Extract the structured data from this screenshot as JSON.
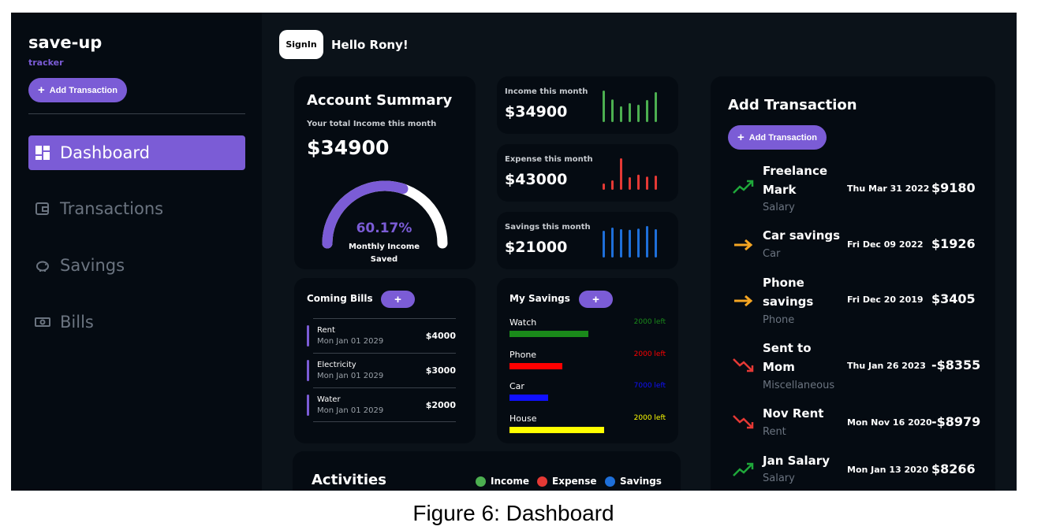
{
  "app": {
    "title": "save-up",
    "subtitle": "tracker"
  },
  "sidebar": {
    "add_button": "Add Transaction",
    "items": [
      {
        "label": "Dashboard",
        "icon": "dashboard-icon",
        "active": true
      },
      {
        "label": "Transactions",
        "icon": "wallet-icon"
      },
      {
        "label": "Savings",
        "icon": "piggy-bank-icon"
      },
      {
        "label": "Bills",
        "icon": "banknote-icon"
      }
    ]
  },
  "header": {
    "signin_label": "SignIn",
    "greeting": "Hello Rony!"
  },
  "account_summary": {
    "title": "Account Summary",
    "subtitle": "Your total Income this month",
    "amount": "$34900",
    "percent_text": "60.17%",
    "percent_value": 0.6017,
    "label": "Monthly Income Saved"
  },
  "stats": [
    {
      "label": "Income this month",
      "value": "$34900",
      "color": "#4caf50",
      "bars": [
        1.0,
        0.72,
        0.5,
        0.6,
        0.55,
        0.7,
        0.95
      ]
    },
    {
      "label": "Expense this month",
      "value": "$43000",
      "color": "#e53935",
      "bars": [
        0.2,
        0.3,
        1.0,
        0.4,
        0.48,
        0.42,
        0.45
      ]
    },
    {
      "label": "Savings this month",
      "value": "$21000",
      "color": "#1e6fd9",
      "bars": [
        0.85,
        0.95,
        0.9,
        0.88,
        0.92,
        1.0,
        0.9
      ]
    }
  ],
  "coming_bills": {
    "title": "Coming Bills",
    "add_label": "+",
    "items": [
      {
        "name": "Rent",
        "date": "Mon Jan 01 2029",
        "amount": "$4000"
      },
      {
        "name": "Electricity",
        "date": "Mon Jan 01 2029",
        "amount": "$3000"
      },
      {
        "name": "Water",
        "date": "Mon Jan 01 2029",
        "amount": "$2000"
      }
    ]
  },
  "my_savings": {
    "title": "My Savings",
    "add_label": "+",
    "items": [
      {
        "name": "Watch",
        "left": "2000 left",
        "color": "#1a8a1a",
        "progress": 0.51
      },
      {
        "name": "Phone",
        "left": "2000 left",
        "color": "#ff0000",
        "progress": 0.34
      },
      {
        "name": "Car",
        "left": "7000 left",
        "color": "#1010ff",
        "progress": 0.25
      },
      {
        "name": "House",
        "left": "2000 left",
        "color": "#ffff00",
        "progress": 0.61
      }
    ]
  },
  "activities": {
    "title": "Activities",
    "legend": [
      {
        "label": "Income",
        "color": "#4caf50"
      },
      {
        "label": "Expense",
        "color": "#e53935"
      },
      {
        "label": "Savings",
        "color": "#1e6fd9"
      }
    ]
  },
  "add_transaction": {
    "title": "Add Transaction",
    "button": "Add Transaction",
    "items": [
      {
        "name": "Freelance Mark",
        "category": "Salary",
        "date": "Thu Mar 31 2022",
        "amount": "$9180",
        "icon": "trend-up-icon"
      },
      {
        "name": "Car savings",
        "category": "Car",
        "date": "Fri Dec 09 2022",
        "amount": "$1926",
        "icon": "arrow-right-icon"
      },
      {
        "name": "Phone savings",
        "category": "Phone",
        "date": "Fri Dec 20 2019",
        "amount": "$3405",
        "icon": "arrow-right-icon"
      },
      {
        "name": "Sent to Mom",
        "category": "Miscellaneous",
        "date": "Thu Jan 26 2023",
        "amount": "-$8355",
        "icon": "trend-down-icon"
      },
      {
        "name": "Nov Rent",
        "category": "Rent",
        "date": "Mon Nov 16 2020",
        "amount": "-$8979",
        "icon": "trend-down-icon"
      },
      {
        "name": "Jan Salary",
        "category": "Salary",
        "date": "Mon Jan 13 2020",
        "amount": "$8266",
        "icon": "trend-up-icon"
      }
    ]
  },
  "caption": "Figure 6: Dashboard"
}
